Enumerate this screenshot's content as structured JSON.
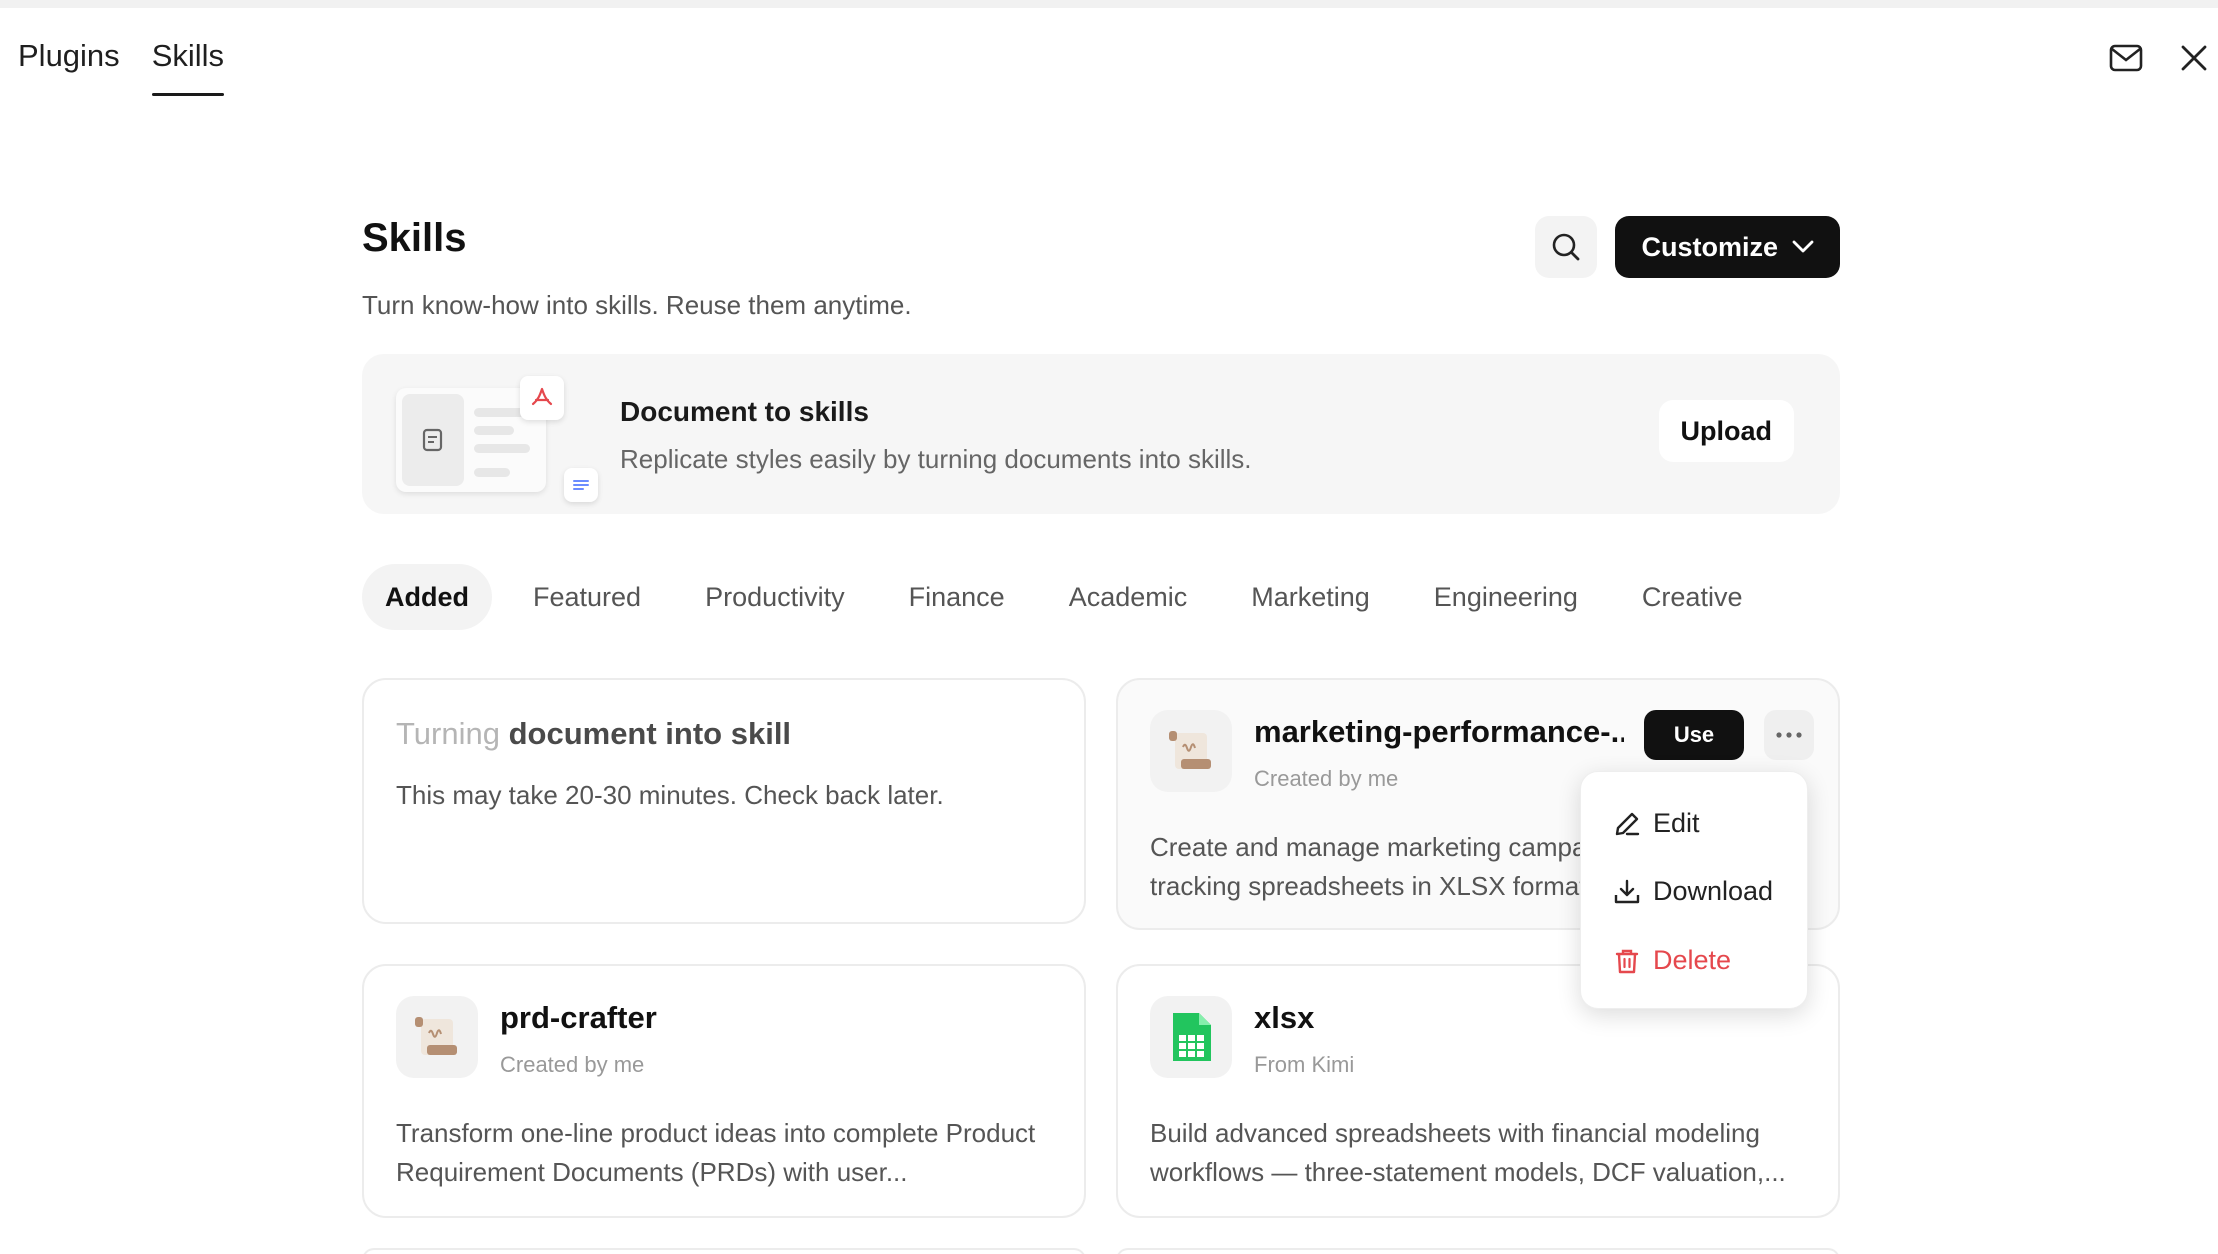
{
  "header": {
    "tabs": [
      {
        "label": "Plugins",
        "active": false
      },
      {
        "label": "Skills",
        "active": true
      }
    ],
    "icons": [
      "mail-icon",
      "close-icon"
    ]
  },
  "page": {
    "title": "Skills",
    "subtitle": "Turn know-how into skills. Reuse them anytime.",
    "customize_label": "Customize"
  },
  "banner": {
    "title": "Document to skills",
    "text": "Replicate styles easily by turning documents into skills.",
    "upload_label": "Upload"
  },
  "categories": [
    {
      "label": "Added",
      "active": true
    },
    {
      "label": "Featured",
      "active": false
    },
    {
      "label": "Productivity",
      "active": false
    },
    {
      "label": "Finance",
      "active": false
    },
    {
      "label": "Academic",
      "active": false
    },
    {
      "label": "Marketing",
      "active": false
    },
    {
      "label": "Engineering",
      "active": false
    },
    {
      "label": "Creative",
      "active": false
    }
  ],
  "pending_card": {
    "title_dim": "Turning",
    "title_rest": " document into skill",
    "desc": "This may take 20-30 minutes. Check back later."
  },
  "skills": [
    {
      "name": "marketing-performance-...",
      "meta": "Created by me",
      "desc_line1": "Create and manage marketing campaign",
      "desc_line2": "tracking spreadsheets in XLSX format.",
      "use_label": "Use",
      "icon": "scroll-doc-icon"
    },
    {
      "name": "prd-crafter",
      "meta": "Created by me",
      "desc": "Transform one-line product ideas into complete Product Requirement Documents (PRDs) with user...",
      "icon": "scroll-doc-icon"
    },
    {
      "name": "xlsx",
      "meta": "From Kimi",
      "desc": "Build advanced spreadsheets with financial modeling workflows — three-statement models, DCF valuation,...",
      "icon": "spreadsheet-icon"
    }
  ],
  "menu": {
    "edit": "Edit",
    "download": "Download",
    "delete": "Delete"
  },
  "colors": {
    "accent": "#111111",
    "danger": "#e5484d",
    "spreadsheet": "#22c55e"
  }
}
